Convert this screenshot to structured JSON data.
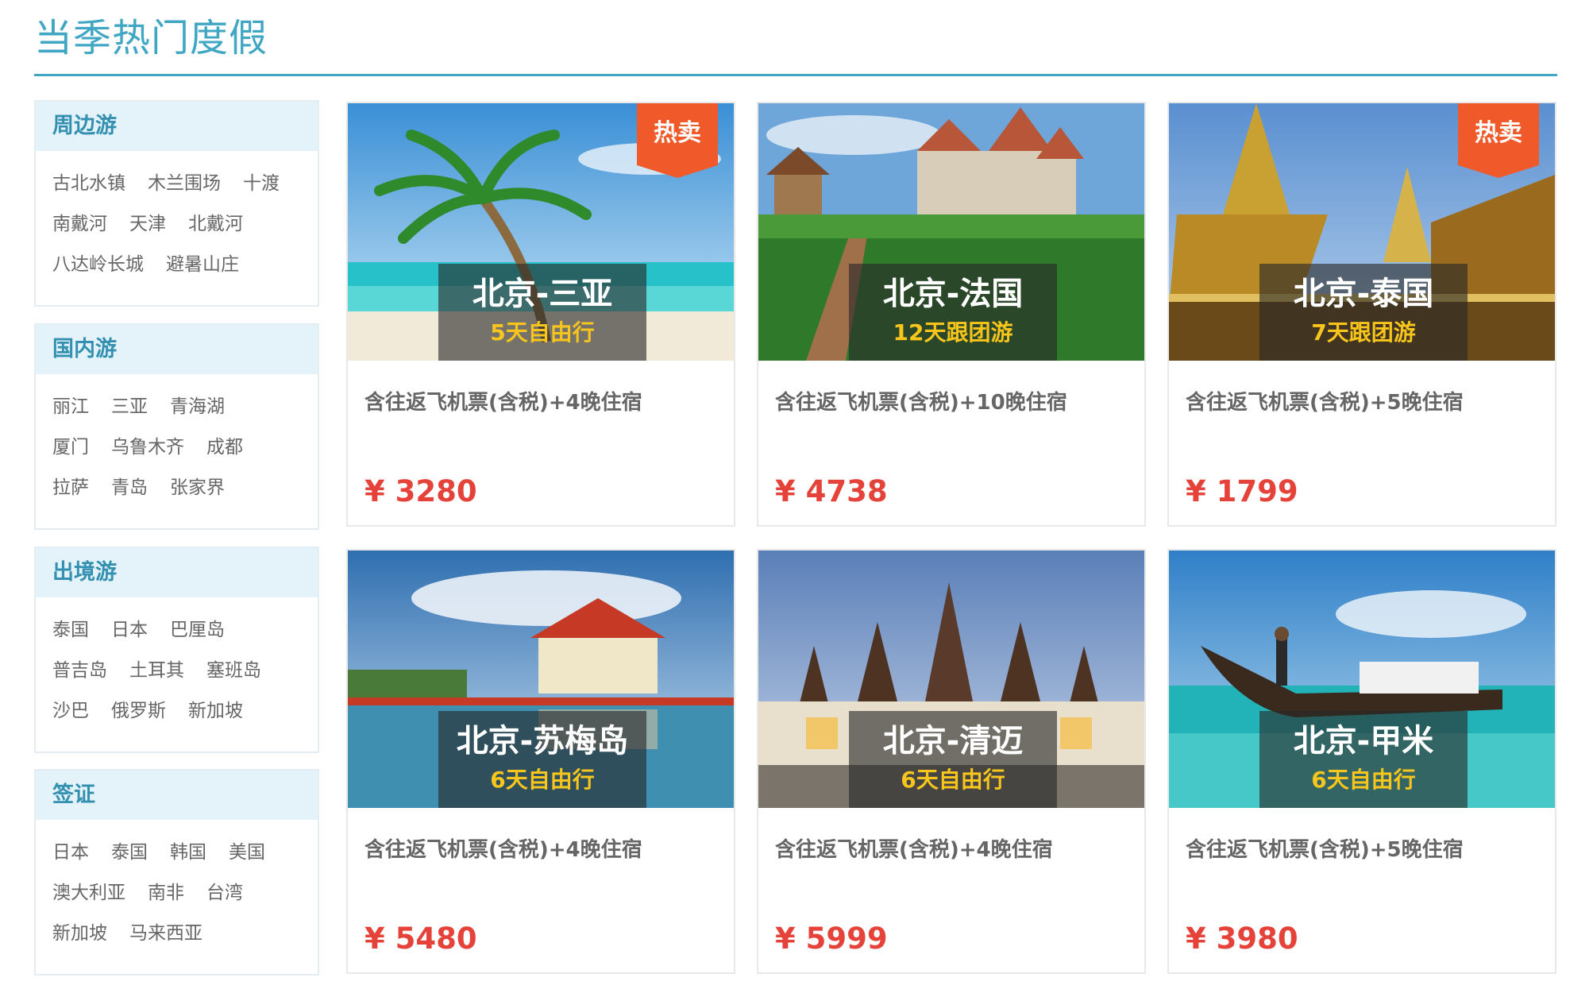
{
  "section_title": "当季热门度假",
  "sidebar": [
    {
      "heading": "周边游",
      "rows": [
        [
          "古北水镇",
          "木兰围场",
          "十渡"
        ],
        [
          "南戴河",
          "天津",
          "北戴河"
        ],
        [
          "八达岭长城",
          "避暑山庄"
        ]
      ]
    },
    {
      "heading": "国内游",
      "rows": [
        [
          "丽江",
          "三亚",
          "青海湖"
        ],
        [
          "厦门",
          "乌鲁木齐",
          "成都"
        ],
        [
          "拉萨",
          "青岛",
          "张家界"
        ]
      ]
    },
    {
      "heading": "出境游",
      "rows": [
        [
          "泰国",
          "日本",
          "巴厘岛"
        ],
        [
          "普吉岛",
          "土耳其",
          "塞班岛"
        ],
        [
          "沙巴",
          "俄罗斯",
          "新加坡"
        ]
      ]
    },
    {
      "heading": "签证",
      "rows": [
        [
          "日本",
          "泰国",
          "韩国",
          "美国"
        ],
        [
          "澳大利亚",
          "南非",
          "台湾"
        ],
        [
          "新加坡",
          "马来西亚"
        ]
      ]
    }
  ],
  "hot_label": "热卖",
  "cards": [
    {
      "route": "北京-三亚",
      "duration": "5天自由行",
      "description": "含往返飞机票(含税)+4晚住宿",
      "price": "¥ 3280",
      "hot": true,
      "scene": "beach-palm-icon"
    },
    {
      "route": "北京-法国",
      "duration": "12天跟团游",
      "description": "含往返飞机票(含税)+10晚住宿",
      "price": "¥ 4738",
      "hot": false,
      "scene": "castle-vineyard-icon"
    },
    {
      "route": "北京-泰国",
      "duration": "7天跟团游",
      "description": "含往返飞机票(含税)+5晚住宿",
      "price": "¥ 1799",
      "hot": true,
      "scene": "golden-temple-icon"
    },
    {
      "route": "北京-苏梅岛",
      "duration": "6天自由行",
      "description": "含往返飞机票(含税)+4晚住宿",
      "price": "¥ 5480",
      "hot": false,
      "scene": "lake-temple-icon"
    },
    {
      "route": "北京-清迈",
      "duration": "6天自由行",
      "description": "含往返飞机票(含税)+4晚住宿",
      "price": "¥ 5999",
      "hot": false,
      "scene": "palace-dusk-icon"
    },
    {
      "route": "北京-甲米",
      "duration": "6天自由行",
      "description": "含往返飞机票(含税)+5晚住宿",
      "price": "¥ 3980",
      "hot": false,
      "scene": "longtail-boat-icon"
    }
  ],
  "colors": {
    "accent": "#3fa6c3",
    "price": "#e5433a",
    "badge": "#f05a2a",
    "duration": "#f7c51b"
  }
}
